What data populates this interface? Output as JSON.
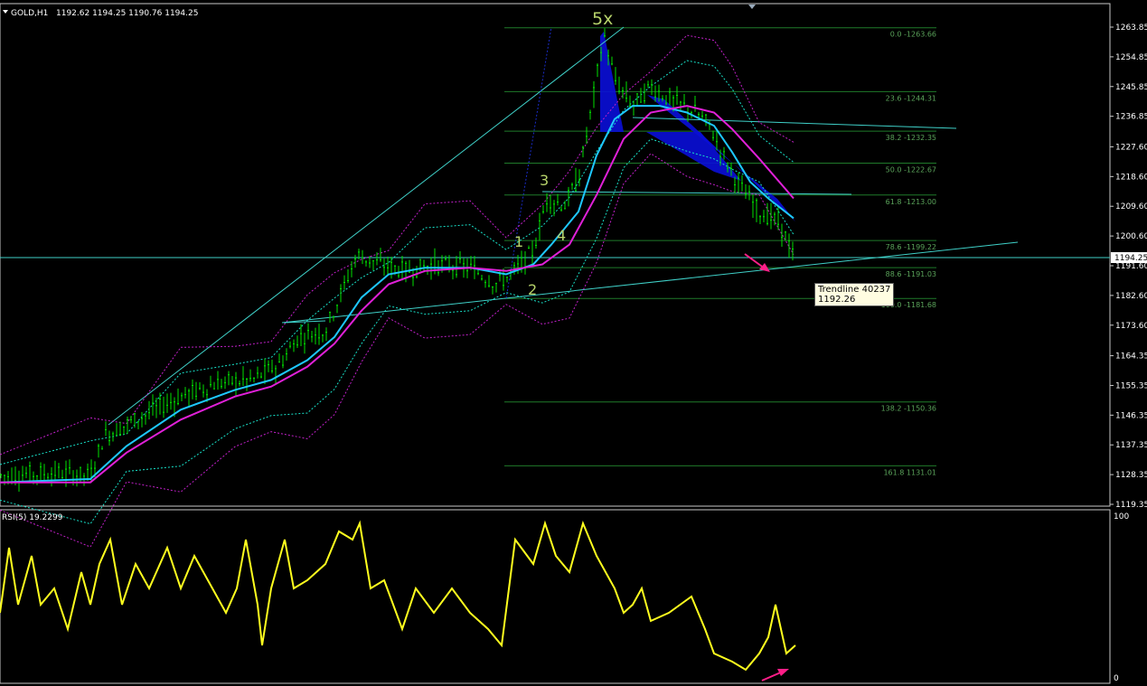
{
  "colors": {
    "background": "#000000",
    "grid_frame": "#c8c8c8",
    "candles": "#00e000",
    "ma_fast": "#1ec8ff",
    "ma_slow": "#e020d8",
    "bands_outer": "#c020c8",
    "bands_inner": "#18e0c8",
    "fib": "#1f7a2a",
    "trendline": "#3fd0c8",
    "rsi": "#ffff1e",
    "pattern_fill": "#0a0ed8",
    "arrow": "#ff1e88",
    "wave_labels": "#b7d36b"
  },
  "header": {
    "symbol": "GOLD,H1",
    "ohlc": "1192.62 1194.25 1190.76 1194.25"
  },
  "price_axis": {
    "ticks": [
      "1263.85",
      "1254.85",
      "1245.85",
      "1236.85",
      "1227.60",
      "1218.60",
      "1209.60",
      "1200.60",
      "1191.60",
      "1182.60",
      "1173.60",
      "1164.35",
      "1155.35",
      "1146.35",
      "1137.35",
      "1128.35",
      "1119.35"
    ],
    "current": "1194.25"
  },
  "fib_levels": [
    "0.0 -1263.66",
    "23.6 -1244.31",
    "38.2 -1232.35",
    "50.0 -1222.67",
    "61.8 -1213.00",
    "78.6 -1199.22",
    "88.6 -1191.03",
    "100.0 -1181.68",
    "138.2 -1150.36",
    "161.8 1131.01"
  ],
  "wave_labels": [
    "1",
    "2",
    "3",
    "4",
    "5x"
  ],
  "tooltip": {
    "name": "Trendline 40237",
    "value": "1192.26"
  },
  "rsi": {
    "label": "RSI(5) 19.2299",
    "top": "100",
    "bottom": "0"
  },
  "chart_data": {
    "type": "line",
    "title": "GOLD,H1",
    "ylim": [
      1119.35,
      1263.85
    ],
    "rsi_ylim": [
      0,
      100
    ],
    "close_path": [
      [
        0,
        1128
      ],
      [
        60,
        1129
      ],
      [
        100,
        1128
      ],
      [
        115,
        1140
      ],
      [
        150,
        1145
      ],
      [
        200,
        1152
      ],
      [
        240,
        1156
      ],
      [
        280,
        1157
      ],
      [
        310,
        1162
      ],
      [
        330,
        1170
      ],
      [
        360,
        1172
      ],
      [
        380,
        1185
      ],
      [
        395,
        1195
      ],
      [
        420,
        1192
      ],
      [
        450,
        1190
      ],
      [
        480,
        1192
      ],
      [
        520,
        1191
      ],
      [
        550,
        1186
      ],
      [
        570,
        1190
      ],
      [
        590,
        1196
      ],
      [
        605,
        1212
      ],
      [
        625,
        1210
      ],
      [
        640,
        1218
      ],
      [
        655,
        1240
      ],
      [
        668,
        1262
      ],
      [
        680,
        1248
      ],
      [
        700,
        1240
      ],
      [
        720,
        1246
      ],
      [
        740,
        1242
      ],
      [
        770,
        1238
      ],
      [
        785,
        1234
      ],
      [
        800,
        1225
      ],
      [
        820,
        1215
      ],
      [
        840,
        1208
      ],
      [
        860,
        1205
      ],
      [
        870,
        1200
      ],
      [
        878,
        1194
      ]
    ],
    "ma_fast": [
      [
        0,
        1126
      ],
      [
        100,
        1127
      ],
      [
        140,
        1137
      ],
      [
        200,
        1148
      ],
      [
        260,
        1154
      ],
      [
        300,
        1157
      ],
      [
        340,
        1163
      ],
      [
        370,
        1170
      ],
      [
        400,
        1182
      ],
      [
        430,
        1189
      ],
      [
        470,
        1191
      ],
      [
        520,
        1191
      ],
      [
        560,
        1189
      ],
      [
        590,
        1192
      ],
      [
        610,
        1198
      ],
      [
        640,
        1208
      ],
      [
        660,
        1225
      ],
      [
        680,
        1236
      ],
      [
        700,
        1240
      ],
      [
        730,
        1240
      ],
      [
        760,
        1238
      ],
      [
        790,
        1234
      ],
      [
        810,
        1226
      ],
      [
        830,
        1217
      ],
      [
        850,
        1212
      ],
      [
        878,
        1206
      ]
    ],
    "ma_slow": [
      [
        0,
        1126
      ],
      [
        100,
        1126
      ],
      [
        140,
        1135
      ],
      [
        200,
        1145
      ],
      [
        260,
        1152
      ],
      [
        300,
        1155
      ],
      [
        340,
        1161
      ],
      [
        370,
        1168
      ],
      [
        400,
        1178
      ],
      [
        430,
        1186
      ],
      [
        470,
        1190
      ],
      [
        520,
        1191
      ],
      [
        560,
        1190
      ],
      [
        600,
        1192
      ],
      [
        630,
        1198
      ],
      [
        660,
        1213
      ],
      [
        690,
        1230
      ],
      [
        720,
        1238
      ],
      [
        760,
        1240
      ],
      [
        790,
        1238
      ],
      [
        810,
        1233
      ],
      [
        840,
        1224
      ],
      [
        878,
        1212
      ]
    ],
    "fib_values": [
      1263.66,
      1244.31,
      1232.35,
      1222.67,
      1213.0,
      1199.22,
      1191.03,
      1181.68,
      1150.36,
      1131.01
    ],
    "rsi_values": [
      [
        0,
        40
      ],
      [
        10,
        80
      ],
      [
        20,
        45
      ],
      [
        35,
        75
      ],
      [
        45,
        45
      ],
      [
        60,
        55
      ],
      [
        75,
        30
      ],
      [
        90,
        65
      ],
      [
        100,
        45
      ],
      [
        110,
        70
      ],
      [
        122,
        85
      ],
      [
        135,
        45
      ],
      [
        150,
        70
      ],
      [
        165,
        55
      ],
      [
        185,
        80
      ],
      [
        200,
        55
      ],
      [
        215,
        75
      ],
      [
        235,
        55
      ],
      [
        250,
        40
      ],
      [
        262,
        55
      ],
      [
        272,
        85
      ],
      [
        285,
        45
      ],
      [
        290,
        20
      ],
      [
        300,
        55
      ],
      [
        315,
        85
      ],
      [
        325,
        55
      ],
      [
        340,
        60
      ],
      [
        360,
        70
      ],
      [
        375,
        90
      ],
      [
        390,
        85
      ],
      [
        398,
        95
      ],
      [
        410,
        55
      ],
      [
        425,
        60
      ],
      [
        445,
        30
      ],
      [
        460,
        55
      ],
      [
        480,
        40
      ],
      [
        500,
        55
      ],
      [
        520,
        40
      ],
      [
        540,
        30
      ],
      [
        555,
        20
      ],
      [
        570,
        85
      ],
      [
        590,
        70
      ],
      [
        603,
        95
      ],
      [
        615,
        75
      ],
      [
        630,
        65
      ],
      [
        645,
        95
      ],
      [
        660,
        75
      ],
      [
        680,
        55
      ],
      [
        690,
        40
      ],
      [
        700,
        45
      ],
      [
        710,
        55
      ],
      [
        720,
        35
      ],
      [
        740,
        40
      ],
      [
        765,
        50
      ],
      [
        780,
        30
      ],
      [
        790,
        15
      ],
      [
        810,
        10
      ],
      [
        825,
        5
      ],
      [
        840,
        15
      ],
      [
        850,
        25
      ],
      [
        858,
        45
      ],
      [
        870,
        15
      ],
      [
        880,
        20
      ]
    ]
  }
}
